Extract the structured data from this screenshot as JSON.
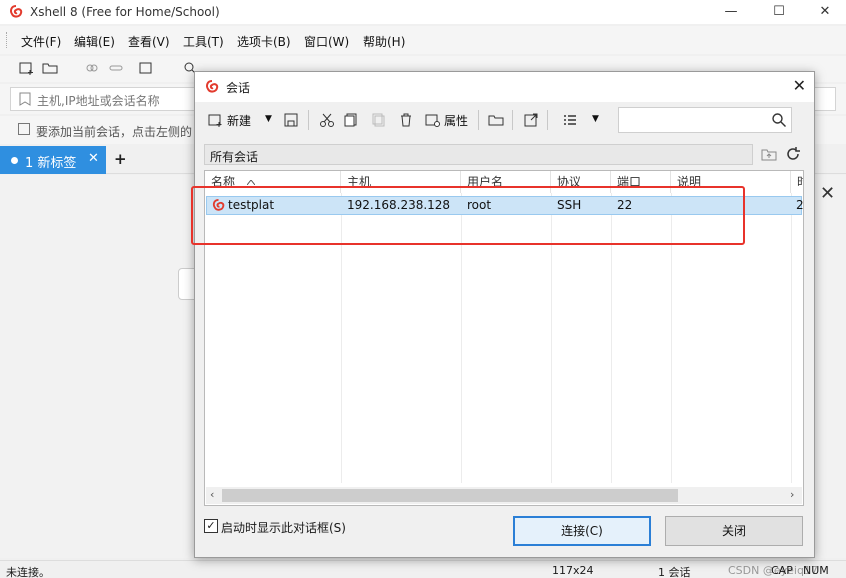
{
  "app": {
    "title": "Xshell 8 (Free for Home/School)",
    "minimize": "—",
    "maximize": "☐",
    "close": "✕"
  },
  "menu": {
    "items": [
      "文件(F)",
      "编辑(E)",
      "查看(V)",
      "工具(T)",
      "选项卡(B)",
      "窗口(W)",
      "帮助(H)"
    ]
  },
  "address": {
    "placeholder": "主机,IP地址或会话名称"
  },
  "hint": {
    "text": "要添加当前会话，点击左侧的"
  },
  "tabs": {
    "active_label": "1 新标签",
    "close": "✕",
    "new": "+"
  },
  "status": {
    "left": "未连接。",
    "size": "117x24",
    "sessions": "1 会话",
    "cap": "CAP",
    "num": "NUM",
    "watermark": "CSDN @eyeiq17"
  },
  "dialog": {
    "title": "会话",
    "close": "✕",
    "toolbar": {
      "new_label": "新建",
      "properties_label": "属性"
    },
    "path": "所有会话",
    "columns": [
      "名称",
      "主机",
      "用户名",
      "协议",
      "端口",
      "说明"
    ],
    "sessions": [
      {
        "name": "testplat",
        "host": "192.168.238.128",
        "user": "root",
        "protocol": "SSH",
        "port": "22",
        "note": ""
      }
    ],
    "trailing_col_value": "2",
    "startup_checkbox": {
      "label": "启动时显示此对话框(S)",
      "checked": true
    },
    "connect_button": "连接(C)",
    "close_button": "关闭"
  },
  "colors": {
    "accent": "#2f8fe0",
    "selection": "#cce4f7",
    "highlight_box": "#e8332b"
  }
}
